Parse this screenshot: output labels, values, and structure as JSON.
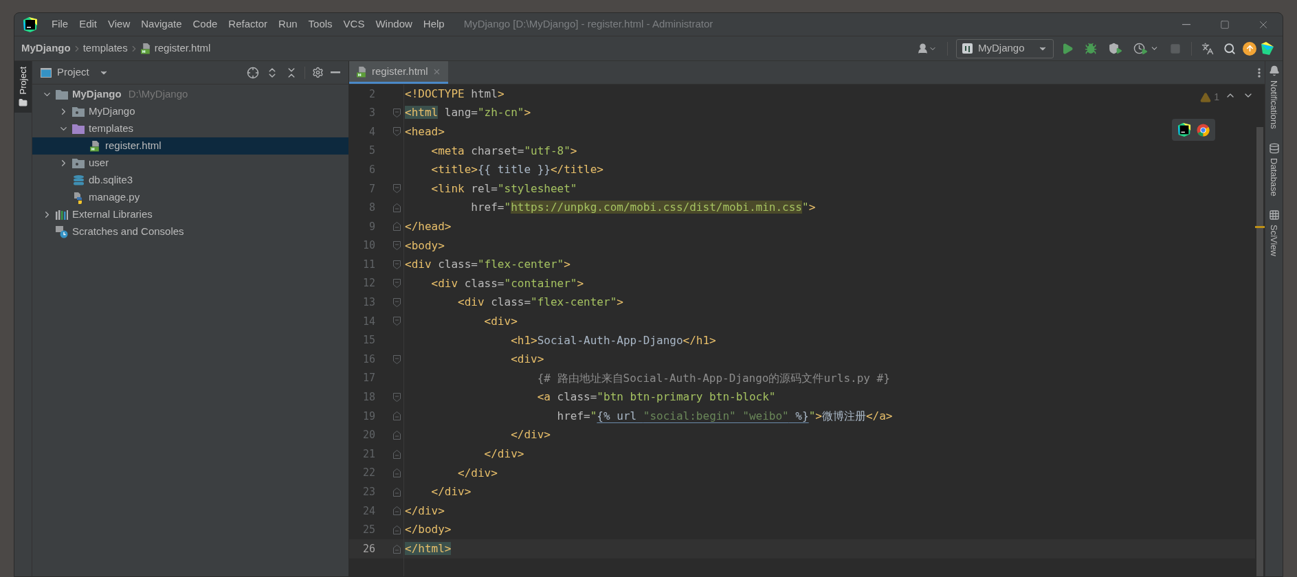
{
  "window": {
    "title": "MyDjango [D:\\MyDjango] - register.html - Administrator"
  },
  "menu": [
    "File",
    "Edit",
    "View",
    "Navigate",
    "Code",
    "Refactor",
    "Run",
    "Tools",
    "VCS",
    "Window",
    "Help"
  ],
  "breadcrumbs": [
    {
      "label": "MyDjango",
      "kind": "project"
    },
    {
      "label": "templates",
      "kind": "folder"
    },
    {
      "label": "register.html",
      "kind": "html-file"
    }
  ],
  "run_config": {
    "label": "MyDjango"
  },
  "toolbar": [
    {
      "kind": "run",
      "disabled": false
    },
    {
      "kind": "debug",
      "disabled": false
    },
    {
      "kind": "coverage",
      "disabled": false
    },
    {
      "kind": "profile",
      "disabled": false
    },
    {
      "kind": "stop",
      "disabled": true
    }
  ],
  "left_stripe": [
    {
      "label": "Project",
      "selected": true
    }
  ],
  "project_panel": {
    "title": "Project",
    "tree": [
      {
        "label": "MyDjango",
        "path": "D:\\MyDjango",
        "kind": "project",
        "expanded": true,
        "selected": false,
        "children": [
          {
            "label": "MyDjango",
            "kind": "package",
            "expanded": false,
            "selected": false
          },
          {
            "label": "templates",
            "kind": "template-folder",
            "expanded": true,
            "selected": false,
            "children": [
              {
                "label": "register.html",
                "kind": "html-file",
                "selected": true
              }
            ]
          },
          {
            "label": "user",
            "kind": "package",
            "expanded": false,
            "selected": false
          },
          {
            "label": "db.sqlite3",
            "kind": "database-file",
            "selected": false
          },
          {
            "label": "manage.py",
            "kind": "python-file",
            "selected": false
          }
        ]
      },
      {
        "label": "External Libraries",
        "kind": "libraries",
        "expanded": false,
        "selected": false
      },
      {
        "label": "Scratches and Consoles",
        "kind": "scratches",
        "selected": false
      }
    ]
  },
  "editor": {
    "tabs": [
      {
        "label": "register.html",
        "selected": true
      }
    ],
    "warnings": "1",
    "lines": [
      {
        "number": "2",
        "fold_start": false,
        "fold_end": false,
        "current": false,
        "tokens": [
          {
            "kind": "tag",
            "text": "<!DOCTYPE"
          },
          {
            "kind": "attr",
            "text": " html"
          },
          {
            "kind": "tag",
            "text": ">"
          }
        ]
      },
      {
        "number": "3",
        "fold_start": true,
        "fold_end": false,
        "current": false,
        "tokens": [
          {
            "kind": "tag-match",
            "text": "<html"
          },
          {
            "kind": "attr",
            "text": " lang="
          },
          {
            "kind": "string",
            "text": "\"zh-cn\""
          },
          {
            "kind": "tag",
            "text": ">"
          }
        ]
      },
      {
        "number": "4",
        "fold_start": true,
        "fold_end": false,
        "current": false,
        "tokens": [
          {
            "kind": "tag",
            "text": "<head>"
          }
        ]
      },
      {
        "number": "5",
        "fold_start": false,
        "fold_end": false,
        "current": false,
        "tokens": [
          {
            "kind": "tag",
            "text": "    <meta"
          },
          {
            "kind": "attr",
            "text": " charset="
          },
          {
            "kind": "string",
            "text": "\"utf-8\""
          },
          {
            "kind": "tag",
            "text": ">"
          }
        ]
      },
      {
        "number": "6",
        "fold_start": false,
        "fold_end": false,
        "current": false,
        "tokens": [
          {
            "kind": "tag",
            "text": "    <title>"
          },
          {
            "kind": "text",
            "text": "{{ title }}"
          },
          {
            "kind": "tag",
            "text": "</title>"
          }
        ]
      },
      {
        "number": "7",
        "fold_start": true,
        "fold_end": false,
        "current": false,
        "tokens": [
          {
            "kind": "tag",
            "text": "    <link"
          },
          {
            "kind": "attr",
            "text": " rel="
          },
          {
            "kind": "string",
            "text": "\"stylesheet\""
          }
        ]
      },
      {
        "number": "8",
        "fold_start": false,
        "fold_end": true,
        "current": false,
        "tokens": [
          {
            "kind": "attr",
            "text": "          href="
          },
          {
            "kind": "string",
            "text": "\""
          },
          {
            "kind": "string-match",
            "text": "https://unpkg.com/mobi.css/dist/mobi.min.css"
          },
          {
            "kind": "string",
            "text": "\""
          },
          {
            "kind": "tag",
            "text": ">"
          }
        ]
      },
      {
        "number": "9",
        "fold_start": false,
        "fold_end": true,
        "current": false,
        "tokens": [
          {
            "kind": "tag",
            "text": "</head>"
          }
        ]
      },
      {
        "number": "10",
        "fold_start": true,
        "fold_end": false,
        "current": false,
        "tokens": [
          {
            "kind": "tag",
            "text": "<body>"
          }
        ]
      },
      {
        "number": "11",
        "fold_start": true,
        "fold_end": false,
        "current": false,
        "tokens": [
          {
            "kind": "tag",
            "text": "<div"
          },
          {
            "kind": "attr",
            "text": " class="
          },
          {
            "kind": "string",
            "text": "\"flex-center\""
          },
          {
            "kind": "tag",
            "text": ">"
          }
        ]
      },
      {
        "number": "12",
        "fold_start": true,
        "fold_end": false,
        "current": false,
        "tokens": [
          {
            "kind": "tag",
            "text": "    <div"
          },
          {
            "kind": "attr",
            "text": " class="
          },
          {
            "kind": "string",
            "text": "\"container\""
          },
          {
            "kind": "tag",
            "text": ">"
          }
        ]
      },
      {
        "number": "13",
        "fold_start": true,
        "fold_end": false,
        "current": false,
        "tokens": [
          {
            "kind": "tag",
            "text": "        <div"
          },
          {
            "kind": "attr",
            "text": " class="
          },
          {
            "kind": "string",
            "text": "\"flex-center\""
          },
          {
            "kind": "tag",
            "text": ">"
          }
        ]
      },
      {
        "number": "14",
        "fold_start": true,
        "fold_end": false,
        "current": false,
        "tokens": [
          {
            "kind": "tag",
            "text": "            <div>"
          }
        ]
      },
      {
        "number": "15",
        "fold_start": false,
        "fold_end": false,
        "current": false,
        "tokens": [
          {
            "kind": "tag",
            "text": "                <h1>"
          },
          {
            "kind": "text",
            "text": "Social-Auth-App-Django"
          },
          {
            "kind": "tag",
            "text": "</h1>"
          }
        ]
      },
      {
        "number": "16",
        "fold_start": true,
        "fold_end": false,
        "current": false,
        "tokens": [
          {
            "kind": "tag",
            "text": "                <div>"
          }
        ]
      },
      {
        "number": "17",
        "fold_start": false,
        "fold_end": false,
        "current": false,
        "tokens": [
          {
            "kind": "comment",
            "text": "                    {# 路由地址来自Social-Auth-App-Django的源码文件urls.py #}"
          }
        ]
      },
      {
        "number": "18",
        "fold_start": true,
        "fold_end": false,
        "current": false,
        "tokens": [
          {
            "kind": "tag",
            "text": "                    <a"
          },
          {
            "kind": "attr",
            "text": " class="
          },
          {
            "kind": "string",
            "text": "\"btn btn-primary btn-block\""
          }
        ]
      },
      {
        "number": "19",
        "fold_start": false,
        "fold_end": true,
        "current": false,
        "tokens": [
          {
            "kind": "attr",
            "text": "                       href="
          },
          {
            "kind": "string",
            "text": "\""
          },
          {
            "kind": "template",
            "text": "{% url "
          },
          {
            "kind": "template-string",
            "text": "\"social:begin\" \"weibo\""
          },
          {
            "kind": "template",
            "text": " %}"
          },
          {
            "kind": "string",
            "text": "\""
          },
          {
            "kind": "tag",
            "text": ">"
          },
          {
            "kind": "text",
            "text": "微博注册"
          },
          {
            "kind": "tag",
            "text": "</a>"
          }
        ]
      },
      {
        "number": "20",
        "fold_start": false,
        "fold_end": true,
        "current": false,
        "tokens": [
          {
            "kind": "tag",
            "text": "                </div>"
          }
        ]
      },
      {
        "number": "21",
        "fold_start": false,
        "fold_end": true,
        "current": false,
        "tokens": [
          {
            "kind": "tag",
            "text": "            </div>"
          }
        ]
      },
      {
        "number": "22",
        "fold_start": false,
        "fold_end": true,
        "current": false,
        "tokens": [
          {
            "kind": "tag",
            "text": "        </div>"
          }
        ]
      },
      {
        "number": "23",
        "fold_start": false,
        "fold_end": true,
        "current": false,
        "tokens": [
          {
            "kind": "tag",
            "text": "    </div>"
          }
        ]
      },
      {
        "number": "24",
        "fold_start": false,
        "fold_end": true,
        "current": false,
        "tokens": [
          {
            "kind": "tag",
            "text": "</div>"
          }
        ]
      },
      {
        "number": "25",
        "fold_start": false,
        "fold_end": true,
        "current": false,
        "tokens": [
          {
            "kind": "tag",
            "text": "</body>"
          }
        ]
      },
      {
        "number": "26",
        "fold_start": false,
        "fold_end": true,
        "current": true,
        "tokens": [
          {
            "kind": "tag-match",
            "text": "</html>"
          }
        ]
      }
    ]
  },
  "right_stripe": [
    {
      "label": "Notifications",
      "kind": "bell"
    },
    {
      "label": "Database",
      "kind": "database"
    },
    {
      "label": "SciView",
      "kind": "grid"
    }
  ]
}
